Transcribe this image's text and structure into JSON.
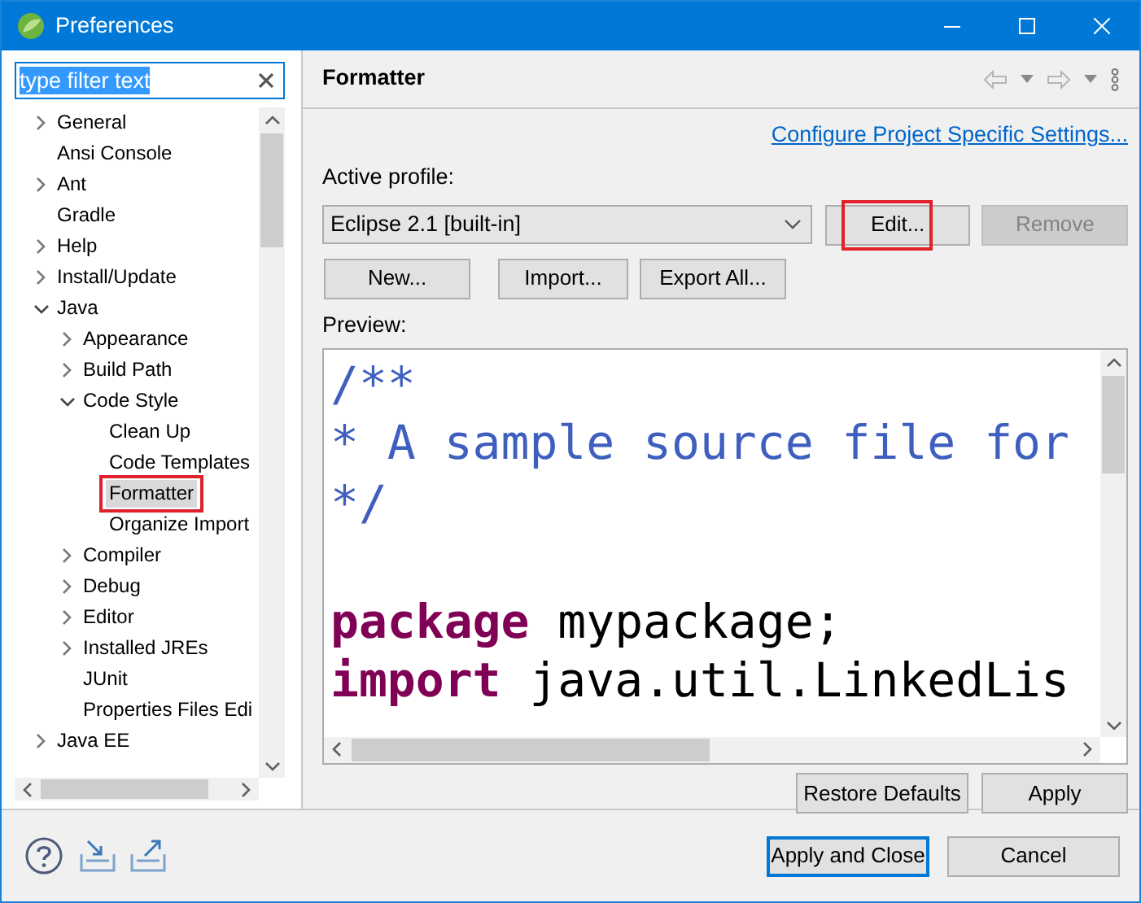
{
  "window": {
    "title": "Preferences"
  },
  "filter": {
    "value": "type filter text",
    "selected": true
  },
  "tree": [
    {
      "label": "General",
      "expanded": false,
      "selected": false
    },
    {
      "label": "Ansi Console",
      "selected": false
    },
    {
      "label": "Ant",
      "expanded": false,
      "selected": false
    },
    {
      "label": "Gradle",
      "selected": false
    },
    {
      "label": "Help",
      "expanded": false,
      "selected": false
    },
    {
      "label": "Install/Update",
      "expanded": false,
      "selected": false
    },
    {
      "label": "Java",
      "expanded": true,
      "selected": false,
      "children": [
        {
          "label": "Appearance",
          "expanded": false,
          "selected": false
        },
        {
          "label": "Build Path",
          "expanded": false,
          "selected": false
        },
        {
          "label": "Code Style",
          "expanded": true,
          "selected": false,
          "children": [
            {
              "label": "Clean Up",
              "selected": false
            },
            {
              "label": "Code Templates",
              "selected": false
            },
            {
              "label": "Formatter",
              "selected": true,
              "annotated": true
            },
            {
              "label": "Organize Import",
              "selected": false
            }
          ]
        },
        {
          "label": "Compiler",
          "expanded": false,
          "selected": false
        },
        {
          "label": "Debug",
          "expanded": false,
          "selected": false
        },
        {
          "label": "Editor",
          "expanded": false,
          "selected": false
        },
        {
          "label": "Installed JREs",
          "expanded": false,
          "selected": false
        },
        {
          "label": "JUnit",
          "selected": false
        },
        {
          "label": "Properties Files Edi",
          "selected": false
        }
      ]
    },
    {
      "label": "Java EE",
      "expanded": false,
      "selected": false
    }
  ],
  "page": {
    "title": "Formatter",
    "link": "Configure Project Specific Settings...",
    "profile_label": "Active profile:",
    "profile": "Eclipse 2.1 [built-in]",
    "profile_buttons": [
      {
        "label": "Edit...",
        "disabled": false,
        "annotated": true
      },
      {
        "label": "Remove",
        "disabled": true,
        "annotated": false
      }
    ],
    "actions": [
      {
        "label": "New..."
      },
      {
        "label": "Import..."
      },
      {
        "label": "Export All..."
      }
    ],
    "preview_label": "Preview:",
    "preview_lines": [
      {
        "segments": [
          {
            "kind": "comment",
            "text": "/**"
          }
        ]
      },
      {
        "segments": [
          {
            "kind": "comment",
            "text": "* A sample source file for"
          }
        ]
      },
      {
        "segments": [
          {
            "kind": "comment",
            "text": "*/"
          }
        ]
      },
      {
        "spaced_before": true,
        "segments": [
          {
            "kind": "keyword",
            "text": "package"
          },
          {
            "kind": "plain",
            "text": " mypackage;"
          }
        ]
      },
      {
        "segments": [
          {
            "kind": "keyword",
            "text": "import"
          },
          {
            "kind": "plain",
            "text": " java.util.LinkedLis"
          }
        ]
      }
    ],
    "buttons": [
      {
        "label": "Restore Defaults"
      },
      {
        "label": "Apply"
      }
    ]
  },
  "footer": {
    "buttons": [
      {
        "label": "Apply and Close",
        "default": true
      },
      {
        "label": "Cancel",
        "default": false
      }
    ]
  }
}
